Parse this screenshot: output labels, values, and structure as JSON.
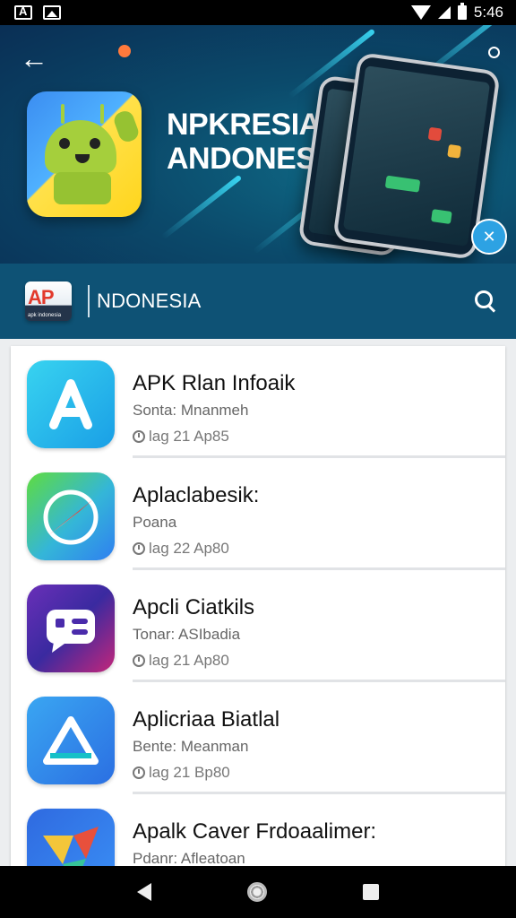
{
  "status_bar": {
    "time": "5:46",
    "left_icons": [
      "app-a-icon",
      "gallery-icon"
    ],
    "right_icons": [
      "wifi-icon",
      "signal-icon",
      "battery-icon"
    ]
  },
  "banner": {
    "title_line1": "NPKRESIA",
    "title_line2": "ANDONESIA",
    "back_icon": "back-arrow-icon",
    "share_icon": "share-icon",
    "fab_icon": "x-icon",
    "fab_text": "✕"
  },
  "header": {
    "logo_text": "AP",
    "logo_accent": "P",
    "logo_sub": "apk indonesia",
    "title": "NDONESIA",
    "search_icon": "search-icon"
  },
  "list": {
    "items": [
      {
        "title": "APK Rlan Infoaik",
        "subtitle": "Sonta: Mnanmeh",
        "meta": "lag 21 Ap85",
        "icon": "a-letter-icon"
      },
      {
        "title": "Aplaclabesik:",
        "subtitle": "Poana",
        "meta": "lag 22 Ap80",
        "icon": "safari-compass-icon"
      },
      {
        "title": "Apcli Ciatkils",
        "subtitle": "Tonar: ASIbadia",
        "meta": "lag 21 Ap80",
        "icon": "chat-bubble-icon"
      },
      {
        "title": "Aplicriaa Biatlal",
        "subtitle": "Bente: Meanman",
        "meta": "lag 21 Bp80",
        "icon": "triangle-drive-icon"
      },
      {
        "title": "Apalk Caver Frdoaalimer:",
        "subtitle": "Pdanr: Afleatoan",
        "meta": "",
        "icon": "colorful-shapes-icon"
      }
    ]
  },
  "nav": {
    "back": "nav-back-icon",
    "home": "nav-home-icon",
    "recents": "nav-recents-icon"
  },
  "colors": {
    "header_bg": "#0e5275",
    "banner_bg": "#0b4a6b",
    "accent_cyan": "#3de2ff",
    "list_bg": "#ffffff"
  }
}
